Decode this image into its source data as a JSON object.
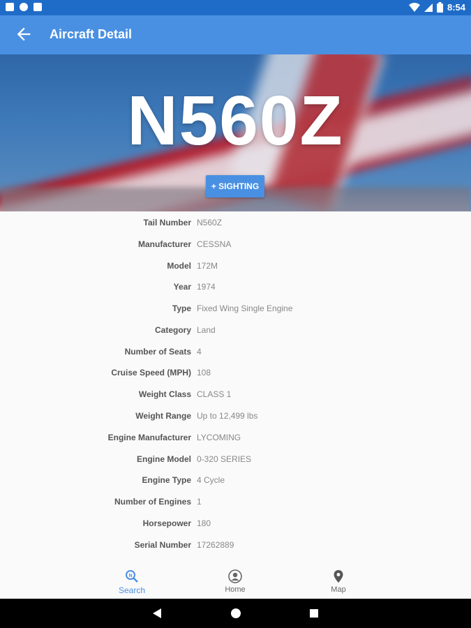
{
  "status_bar": {
    "time": "8:54",
    "icons": [
      "a-notification-icon",
      "circle-notification-icon",
      "sd-card-icon",
      "wifi-icon",
      "signal-icon",
      "battery-icon"
    ]
  },
  "app_bar": {
    "title": "Aircraft Detail",
    "back_icon": "arrow-back-icon"
  },
  "hero": {
    "tail_number": "N560Z",
    "sighting_button": "+ SIGHTING"
  },
  "details": [
    {
      "label": "Tail Number",
      "value": "N560Z"
    },
    {
      "label": "Manufacturer",
      "value": "CESSNA"
    },
    {
      "label": "Model",
      "value": "172M"
    },
    {
      "label": "Year",
      "value": "1974"
    },
    {
      "label": "Type",
      "value": "Fixed Wing Single Engine"
    },
    {
      "label": "Category",
      "value": "Land"
    },
    {
      "label": "Number of Seats",
      "value": "4"
    },
    {
      "label": "Cruise Speed (MPH)",
      "value": "108"
    },
    {
      "label": "Weight Class",
      "value": "CLASS 1"
    },
    {
      "label": "Weight Range",
      "value": "Up to 12,499 lbs"
    },
    {
      "label": "Engine Manufacturer",
      "value": "LYCOMING"
    },
    {
      "label": "Engine Model",
      "value": "0-320 SERIES"
    },
    {
      "label": "Engine Type",
      "value": "4 Cycle"
    },
    {
      "label": "Number of Engines",
      "value": "1"
    },
    {
      "label": "Horsepower",
      "value": "180"
    },
    {
      "label": "Serial Number",
      "value": "17262889"
    }
  ],
  "bottom_nav": [
    {
      "label": "Search",
      "icon": "search-icon",
      "active": true
    },
    {
      "label": "Home",
      "icon": "person-icon",
      "active": false
    },
    {
      "label": "Map",
      "icon": "map-pin-icon",
      "active": false
    }
  ],
  "colors": {
    "status_bar": "#1f6cc8",
    "app_bar": "#4a90e2",
    "accent": "#4a90e2"
  }
}
